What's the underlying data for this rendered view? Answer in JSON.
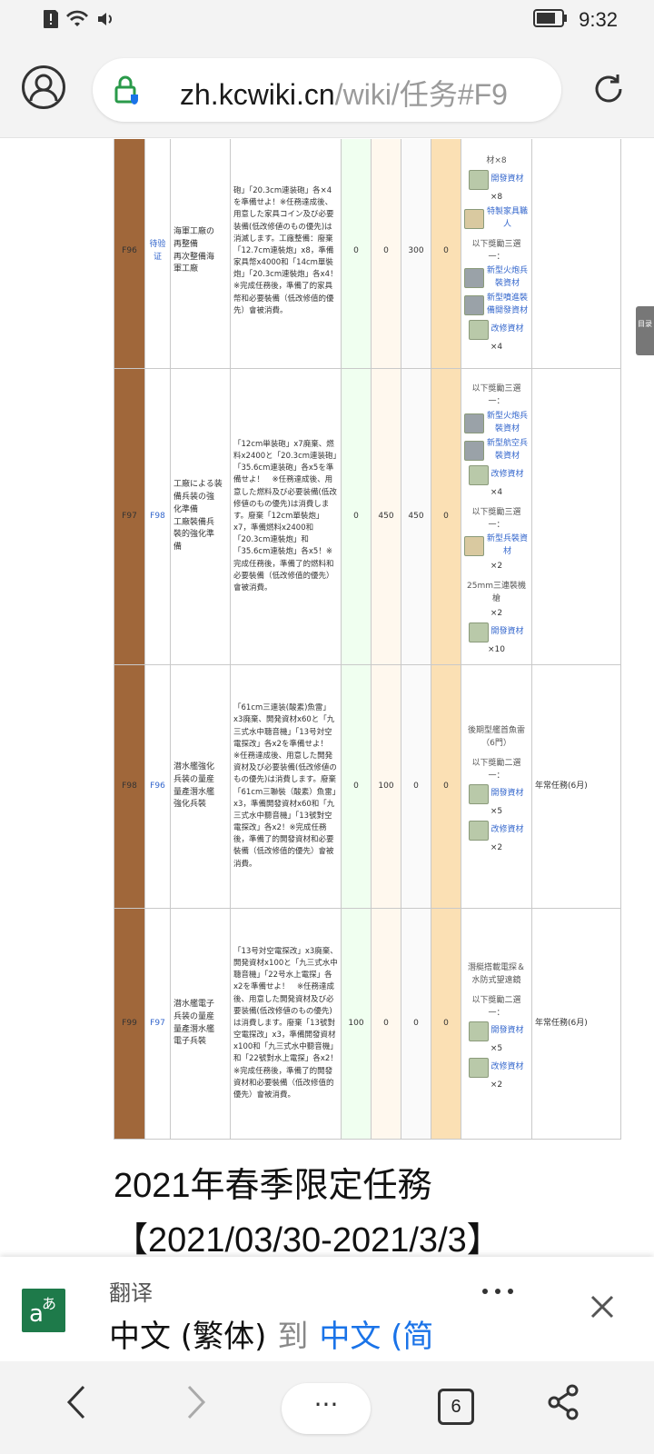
{
  "status_bar": {
    "time": "9:32",
    "icons": [
      "alert-icon",
      "wifi-icon",
      "volume-icon",
      "battery-icon"
    ]
  },
  "browser": {
    "url_host": "zh.kcwiki.cn",
    "url_path": "/wiki/任务#F9"
  },
  "quests": [
    {
      "id": "F96",
      "prerequisite": "待验证",
      "name_lines": [
        "海軍工廠の",
        "再整備",
        "再次整備海",
        "軍工廠"
      ],
      "description": "砲」「20.3cm連装砲」各×4を準備せよ！※任務達成後、用意した家具コイン及び必要装備(低改修値のもの優先)は消滅します。工廠整備：廢棄「12.7cm連裝炮」x8，準備家具幣x4000和「14cm單裝炮」「20.3cm連裝炮」各x4！※完成任務後，準備了的家具幣和必要裝備（低改修值的優先）會被消費。",
      "rewards": [
        "0",
        "0",
        "300",
        "0"
      ],
      "reward_items": [
        {
          "label": "材×8",
          "icon": ""
        },
        {
          "label": "開發資材",
          "qty": "×8",
          "icon": "material-icon"
        },
        {
          "label": "特製家具職人",
          "icon": "furniture-icon"
        },
        {
          "label": "以下獎勵三選一：",
          "icon": ""
        },
        {
          "label": "新型火炮兵裝資材",
          "icon": "gun-icon"
        },
        {
          "label": "新型噴進裝備開發資材",
          "icon": "gun-icon"
        },
        {
          "label": "改修資材",
          "qty": "×4",
          "icon": "material-icon"
        }
      ],
      "note": ""
    },
    {
      "id": "F97",
      "prerequisite": "F98",
      "name_lines": [
        "工廠による装",
        "備兵装の強",
        "化準備",
        "工廠裝備兵",
        "裝的強化準",
        "備"
      ],
      "description": "「12cm単装砲」x7廃棄、燃料x2400と「20.3cm連装砲」「35.6cm連装砲」各x5を準備せよ！　※任務達成後、用意した燃料及び必要装備(低改修値のもの優先)は消費します。廢棄「12cm單裝炮」x7，準備燃料x2400和「20.3cm連裝炮」和「35.6cm連裝炮」各x5！※完成任務後，準備了的燃料和必要裝備（低改修值的優先）會被消費。",
      "rewards": [
        "0",
        "450",
        "450",
        "0"
      ],
      "reward_items": [
        {
          "label": "以下獎勵三選一：",
          "icon": ""
        },
        {
          "label": "新型火炮兵裝資材",
          "icon": "gun-icon"
        },
        {
          "label": "新型航空兵裝資材",
          "icon": "gun-icon"
        },
        {
          "label": "改修資材",
          "qty": "×4",
          "icon": "material-icon"
        },
        {
          "label": "以下獎勵三選一：",
          "icon": ""
        },
        {
          "label": "新型兵裝資材",
          "qty": "×2",
          "icon": "doll-icon"
        },
        {
          "label": "25mm三連裝機槍",
          "qty": "×2",
          "icon": ""
        },
        {
          "label": "開發資材",
          "qty": "×10",
          "icon": "material-icon"
        }
      ],
      "note": ""
    },
    {
      "id": "F98",
      "prerequisite": "F96",
      "name_lines": [
        "潜水艦強化",
        "兵装の量産",
        "量產潛水艦",
        "強化兵裝"
      ],
      "description": "「61cm三連装(酸素)魚雷」x3廃棄、開発資材x60と「九三式水中聴音機」「13号対空電探改」各x2を準備せよ！　※任務達成後、用意した開発資材及び必要装備(低改修値のもの優先)は消費します。廢棄「61cm三聯裝（酸素）魚雷」x3，準備開發資材x60和「九三式水中聽音機」「13號對空電探改」各x2！※完成任務後，準備了的開發資材和必要裝備（低改修值的優先）會被消費。",
      "rewards": [
        "0",
        "100",
        "0",
        "0"
      ],
      "reward_items": [
        {
          "label": "後期型艦首魚雷（6門）",
          "icon": ""
        },
        {
          "label": "以下獎勵二選一：",
          "icon": ""
        },
        {
          "label": "開發資材",
          "qty": "×5",
          "icon": "material-icon"
        },
        {
          "label": "改修資材",
          "qty": "×2",
          "icon": "material-icon"
        }
      ],
      "note": "年常任務(6月)"
    },
    {
      "id": "F99",
      "prerequisite": "F97",
      "name_lines": [
        "潜水艦電子",
        "兵装の量産",
        "量產潛水艦",
        "電子兵裝"
      ],
      "description": "「13号対空電探改」x3廃棄、開発資材x100と「九三式水中聴音機」「22号水上電探」各x2を準備せよ！　※任務達成後、用意した開発資材及び必要装備(低改修値のもの優先)は消費します。廢棄「13號對空電探改」x3，準備開發資材x100和「九三式水中聽音機」和「22號對水上電探」各x2！※完成任務後，準備了的開發資材和必要裝備（低改修值的優先）會被消費。",
      "rewards": [
        "100",
        "0",
        "0",
        "0"
      ],
      "reward_items": [
        {
          "label": "潛艇搭載電探＆水防式望遠鏡",
          "icon": ""
        },
        {
          "label": "以下獎勵二選一：",
          "icon": ""
        },
        {
          "label": "開發資材",
          "qty": "×5",
          "icon": "material-icon"
        },
        {
          "label": "改修資材",
          "qty": "×2",
          "icon": "material-icon"
        }
      ],
      "note": "年常任務(6月)"
    }
  ],
  "section": {
    "title": "2021年春季限定任務",
    "date": "【2021/03/30-2021/3/3】"
  },
  "side_tab": "目录",
  "translate_bar": {
    "title": "翻译",
    "from_lang": "中文 (繁体)",
    "to_word": "到",
    "target_lang": "中文 (简"
  },
  "bottom_nav": {
    "tab_count": "6",
    "menu_label": "···"
  }
}
